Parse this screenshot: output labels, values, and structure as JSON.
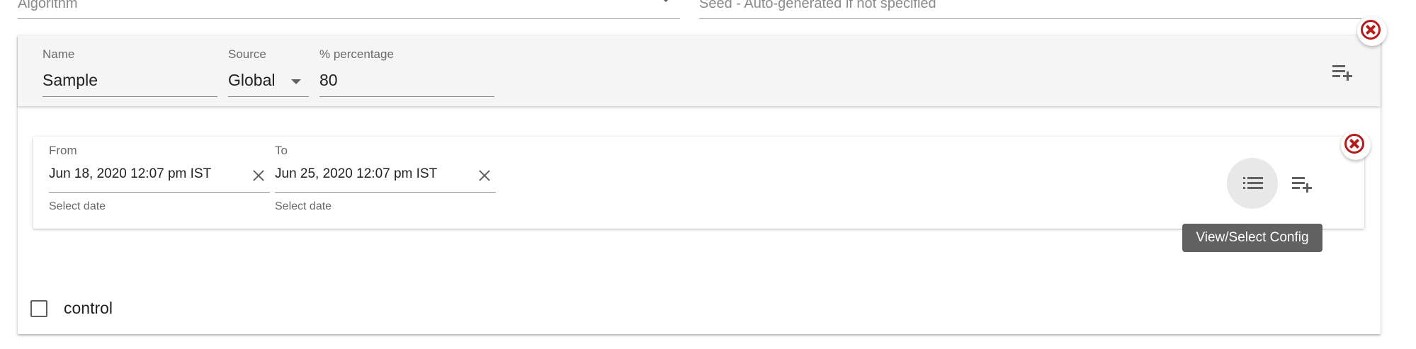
{
  "top_fields": {
    "algorithm_placeholder": "Algorithm",
    "seed_placeholder": "Seed - Auto-generated if not specified"
  },
  "variant": {
    "name_label": "Name",
    "name_value": "Sample",
    "source_label": "Source",
    "source_value": "Global",
    "percentage_label": "% percentage",
    "percentage_value": "80"
  },
  "date_range": {
    "from_label": "From",
    "from_value": "Jun 18, 2020 12:07 pm IST",
    "from_hint": "Select date",
    "to_label": "To",
    "to_value": "Jun 25, 2020 12:07 pm IST",
    "to_hint": "Select date"
  },
  "tooltip": "View/Select Config",
  "control": {
    "label": "control",
    "checked": false
  },
  "colors": {
    "remove_accent": "#b71c1c",
    "tooltip_bg": "#616161",
    "header_bg": "#f5f5f5"
  },
  "icons": [
    "caret-down-icon",
    "remove-icon",
    "playlist-add-icon",
    "clear-icon",
    "list-icon"
  ]
}
